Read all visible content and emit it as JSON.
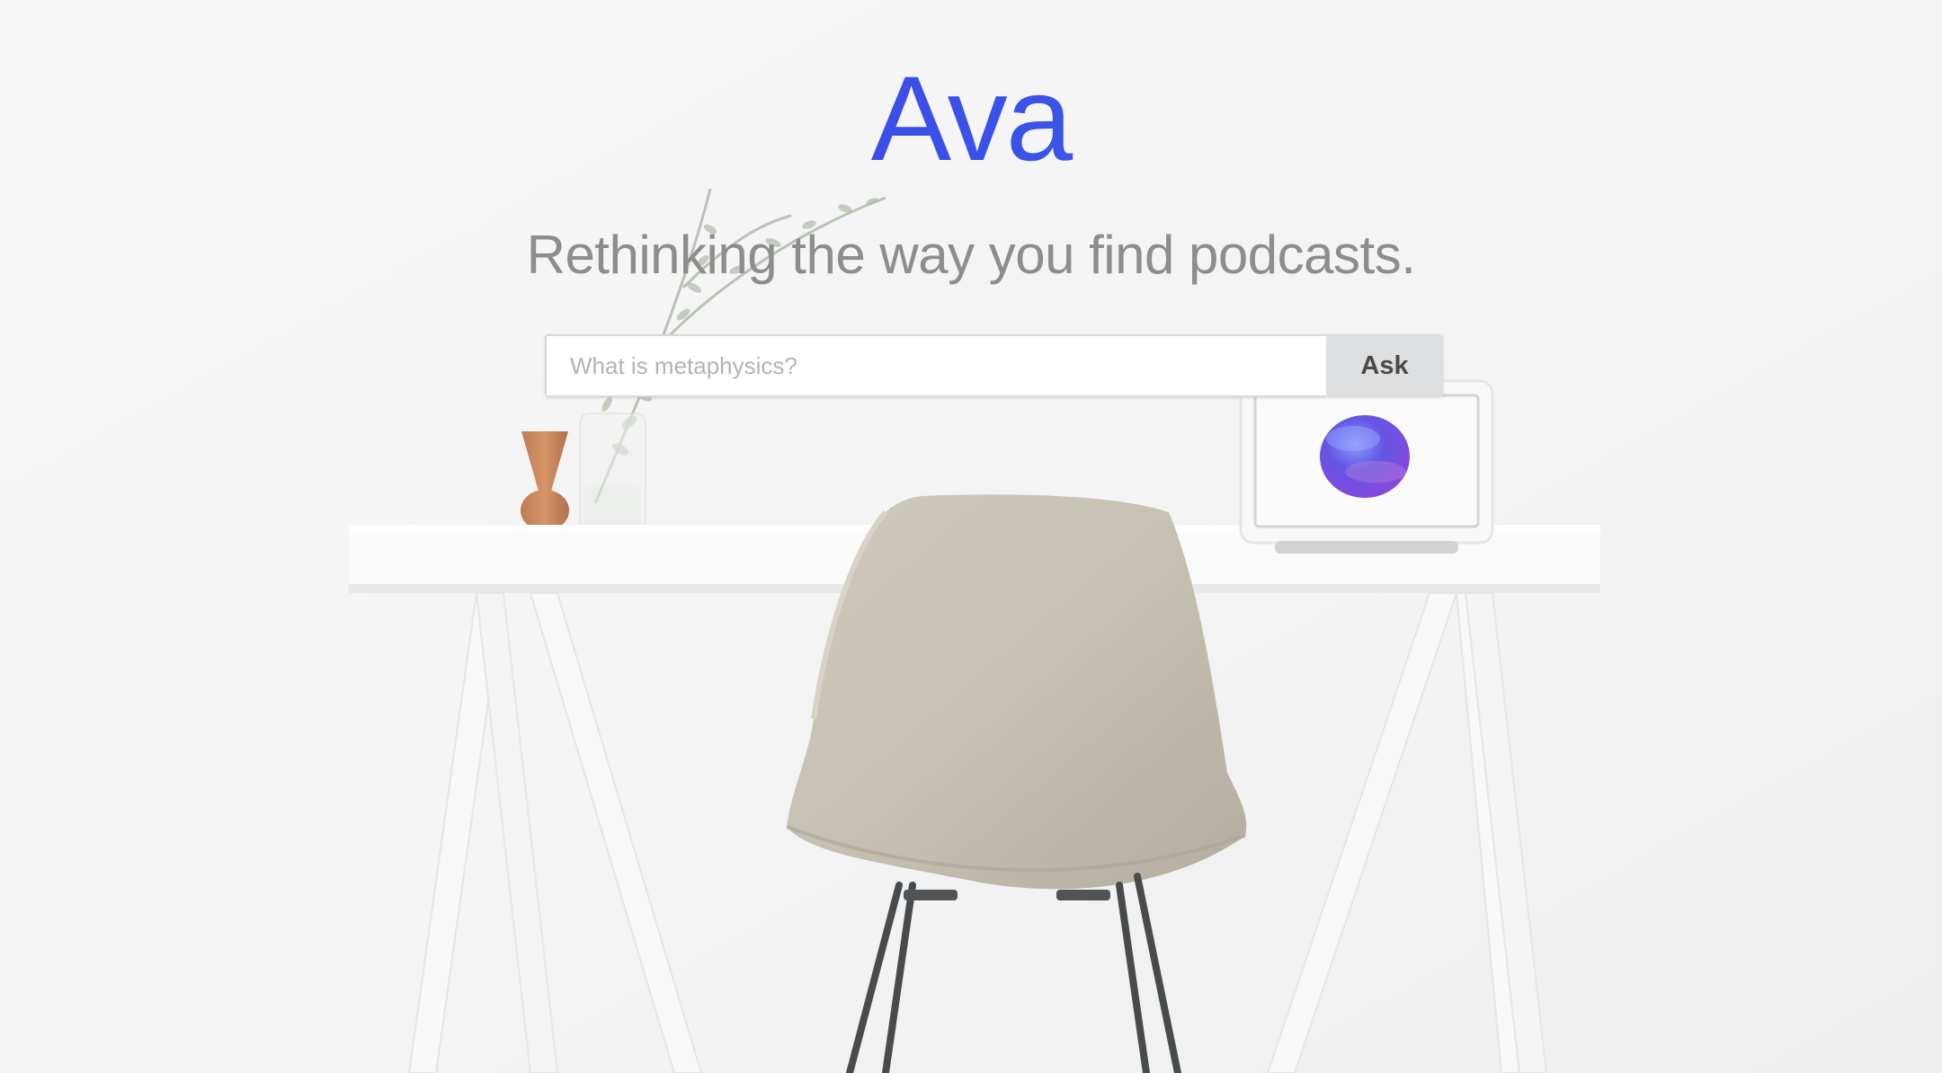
{
  "hero": {
    "title": "Ava",
    "tagline": "Rethinking the way you find podcasts."
  },
  "search": {
    "placeholder": "What is metaphysics?",
    "value": "",
    "button_label": "Ask"
  },
  "colors": {
    "title_gradient_start": "#3e2fe6",
    "title_gradient_end": "#3a8ee9",
    "tagline": "#8d8d8d",
    "button_bg": "#dedfe0",
    "background": "#f4f4f4"
  },
  "icons": [
    "ava-orb-icon"
  ]
}
